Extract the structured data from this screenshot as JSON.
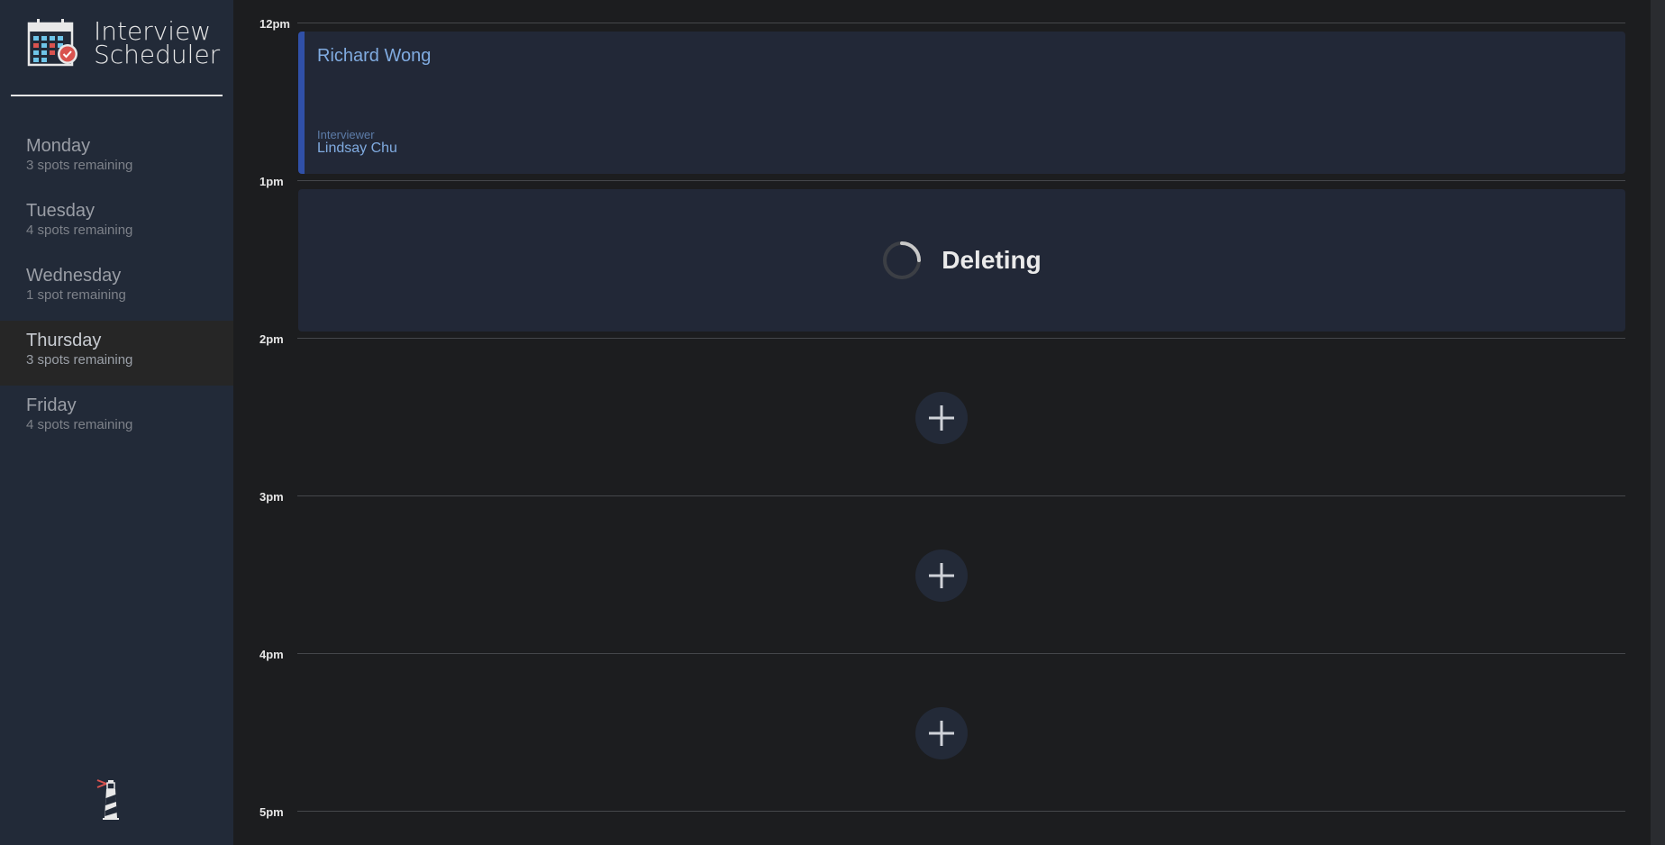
{
  "app": {
    "title_line1": "Interview",
    "title_line2": "Scheduler"
  },
  "sidebar": {
    "days": [
      {
        "name": "Monday",
        "spots": "3 spots remaining",
        "selected": false
      },
      {
        "name": "Tuesday",
        "spots": "4 spots remaining",
        "selected": false
      },
      {
        "name": "Wednesday",
        "spots": "1 spot remaining",
        "selected": false
      },
      {
        "name": "Thursday",
        "spots": "3 spots remaining",
        "selected": true
      },
      {
        "name": "Friday",
        "spots": "4 spots remaining",
        "selected": false
      }
    ]
  },
  "schedule": {
    "slots": [
      {
        "time": "12pm",
        "state": "show",
        "student": "Richard Wong",
        "interviewer_label": "Interviewer",
        "interviewer": "Lindsay Chu"
      },
      {
        "time": "1pm",
        "state": "status",
        "status_text": "Deleting"
      },
      {
        "time": "2pm",
        "state": "empty"
      },
      {
        "time": "3pm",
        "state": "empty"
      },
      {
        "time": "4pm",
        "state": "empty"
      }
    ],
    "end_time": "5pm"
  },
  "colors": {
    "sidebar_bg": "#222a38",
    "main_bg": "#1c1d1f",
    "accent": "#3050a8",
    "link_text": "#80abe0"
  },
  "icons": {
    "logo": "calendar-icon",
    "spinner": "spinner-icon",
    "add": "plus-icon",
    "footer": "lighthouse-icon"
  }
}
